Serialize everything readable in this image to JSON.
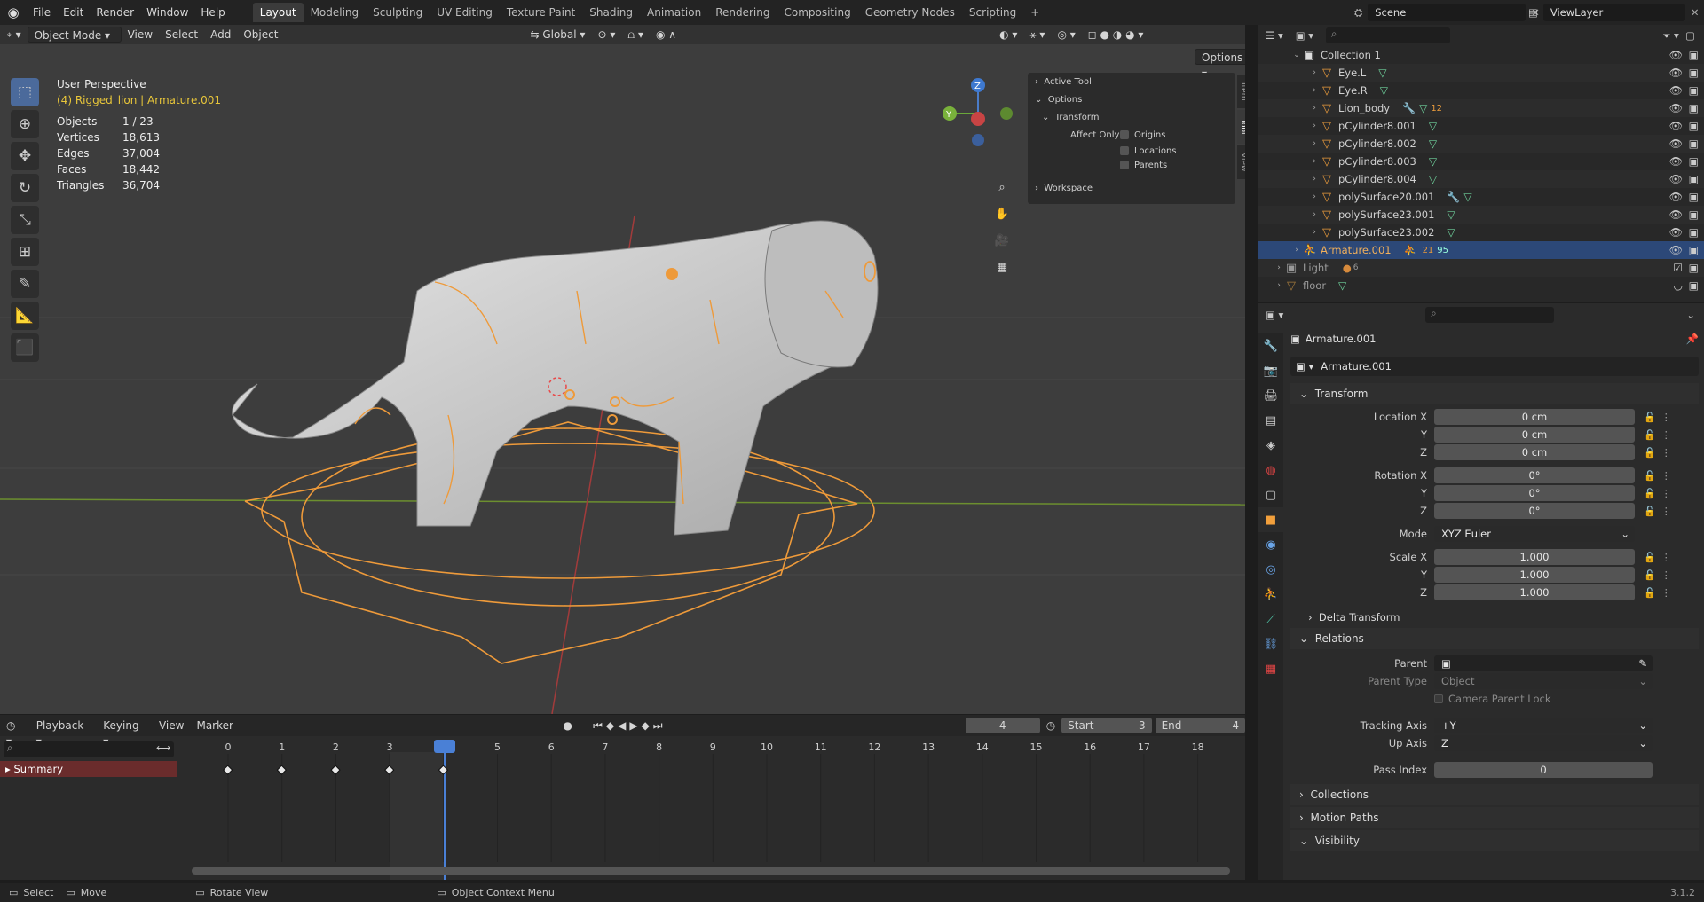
{
  "menu": {
    "items": [
      "File",
      "Edit",
      "Render",
      "Window",
      "Help"
    ]
  },
  "workspaces": {
    "tabs": [
      "Layout",
      "Modeling",
      "Sculpting",
      "UV Editing",
      "Texture Paint",
      "Shading",
      "Animation",
      "Rendering",
      "Compositing",
      "Geometry Nodes",
      "Scripting"
    ],
    "active": "Layout",
    "add": "+"
  },
  "scene": {
    "label": "Scene",
    "layer": "ViewLayer"
  },
  "viewport_header": {
    "mode": "Object Mode",
    "menus": [
      "View",
      "Select",
      "Add",
      "Object"
    ],
    "orientation": "Global",
    "options": "Options"
  },
  "viewport": {
    "title": "User Perspective",
    "subtitle": "(4) Rigged_lion | Armature.001",
    "stats": [
      [
        "Objects",
        "1 / 23"
      ],
      [
        "Vertices",
        "18,613"
      ],
      [
        "Edges",
        "37,004"
      ],
      [
        "Faces",
        "18,442"
      ],
      [
        "Triangles",
        "36,704"
      ]
    ]
  },
  "npanel": {
    "active_tool": "Active Tool",
    "options": "Options",
    "transform": "Transform",
    "affect_only": "Affect Only",
    "origins": "Origins",
    "locations": "Locations",
    "parents": "Parents",
    "workspace": "Workspace",
    "tabs": [
      "Item",
      "Tool",
      "View"
    ]
  },
  "gizmo": {
    "z": "Z",
    "y": "Y"
  },
  "timeline": {
    "menus": [
      "Playback",
      "Keying",
      "View",
      "Marker"
    ],
    "current_frame": "4",
    "start_label": "Start",
    "start": "3",
    "end_label": "End",
    "end": "4",
    "summary": "Summary",
    "frames": [
      "0",
      "1",
      "2",
      "3",
      "4",
      "5",
      "6",
      "7",
      "8",
      "9",
      "10",
      "11",
      "12",
      "13",
      "14",
      "15",
      "16",
      "17",
      "18"
    ]
  },
  "outliner": {
    "items": [
      {
        "name": "Collection 1",
        "type": "collection"
      },
      {
        "name": "Eye.L",
        "type": "mesh"
      },
      {
        "name": "Eye.R",
        "type": "mesh"
      },
      {
        "name": "Lion_body",
        "type": "mesh",
        "badge": "12"
      },
      {
        "name": "pCylinder8.001",
        "type": "mesh"
      },
      {
        "name": "pCylinder8.002",
        "type": "mesh"
      },
      {
        "name": "pCylinder8.003",
        "type": "mesh"
      },
      {
        "name": "pCylinder8.004",
        "type": "mesh"
      },
      {
        "name": "polySurface20.001",
        "type": "mesh"
      },
      {
        "name": "polySurface23.001",
        "type": "mesh"
      },
      {
        "name": "polySurface23.002",
        "type": "mesh"
      },
      {
        "name": "Armature.001",
        "type": "armature",
        "badge": "21",
        "badge2": "95"
      },
      {
        "name": "Light",
        "type": "light",
        "badge": "6"
      },
      {
        "name": "floor",
        "type": "mesh"
      }
    ]
  },
  "properties": {
    "object_name": "Armature.001",
    "datablock": "Armature.001",
    "transform_label": "Transform",
    "location_x_label": "Location X",
    "y_label": "Y",
    "z_label": "Z",
    "location": [
      "0 cm",
      "0 cm",
      "0 cm"
    ],
    "rotation_x_label": "Rotation X",
    "rotation": [
      "0°",
      "0°",
      "0°"
    ],
    "mode_label": "Mode",
    "mode": "XYZ Euler",
    "scale_x_label": "Scale X",
    "scale": [
      "1.000",
      "1.000",
      "1.000"
    ],
    "delta_transform": "Delta Transform",
    "relations": "Relations",
    "parent_label": "Parent",
    "parent_type_label": "Parent Type",
    "parent_type": "Object",
    "camera_parent_lock": "Camera Parent Lock",
    "tracking_axis_label": "Tracking Axis",
    "tracking_axis": "+Y",
    "up_axis_label": "Up Axis",
    "up_axis": "Z",
    "pass_index_label": "Pass Index",
    "pass_index": "0",
    "collections": "Collections",
    "motion_paths": "Motion Paths",
    "visibility": "Visibility"
  },
  "statusbar": {
    "select": "Select",
    "move": "Move",
    "rotate": "Rotate View",
    "context": "Object Context Menu",
    "version": "3.1.2"
  }
}
